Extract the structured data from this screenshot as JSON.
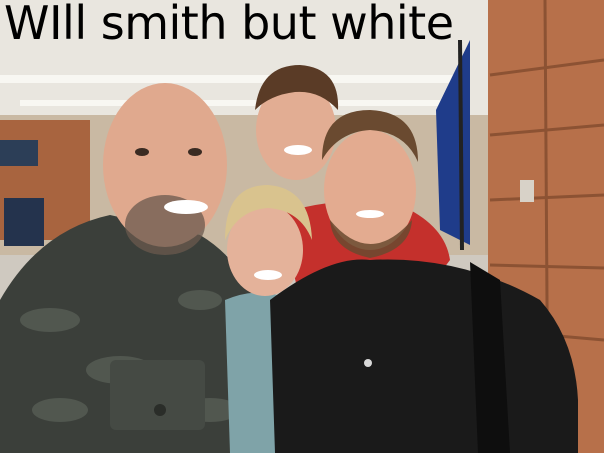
{
  "meme": {
    "caption": "WIll smith but white"
  },
  "scene": {
    "description_icon": "group-selfie-airport",
    "colors": {
      "ceiling": "#e9e6df",
      "wood_panel": "#b7704a",
      "man_left_jacket": "#3b3f3a",
      "man_center_shirt": "#c4302c",
      "man_right_shirt": "#1a1a1a",
      "woman_top": "#7fa3a8",
      "skin": "#e0a98e",
      "hair_blonde": "#d9c38e",
      "hair_brown": "#5a3b26",
      "flag": "#1f3c8a"
    }
  }
}
